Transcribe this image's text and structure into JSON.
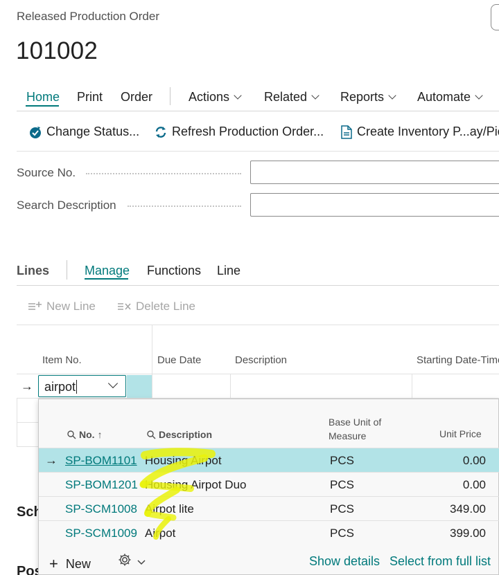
{
  "page": {
    "caption": "Released Production Order",
    "title": "101002"
  },
  "nav": {
    "tabs": [
      {
        "label": "Home"
      },
      {
        "label": "Print"
      },
      {
        "label": "Order"
      },
      {
        "label": "Actions"
      },
      {
        "label": "Related"
      },
      {
        "label": "Reports"
      },
      {
        "label": "Automate"
      }
    ],
    "active": "Home"
  },
  "actions": {
    "change_status": "Change Status...",
    "refresh": "Refresh Production Order...",
    "create_inventory": "Create Inventory P...ay/Pick"
  },
  "fields": {
    "source_no_label": "Source No.",
    "source_no_value": "",
    "search_description_label": "Search Description",
    "search_description_value": ""
  },
  "lines": {
    "title": "Lines",
    "tabs": [
      "Manage",
      "Functions",
      "Line"
    ],
    "active_tab": "Manage",
    "new_line": "New Line",
    "delete_line": "Delete Line",
    "columns": [
      "Item No.",
      "Due Date",
      "Description",
      "Starting Date-Time"
    ],
    "item_input_value": "airpot"
  },
  "sections": {
    "schedule_partial": "Sch",
    "posting_partial": "Posting"
  },
  "lookup": {
    "headers": {
      "no": "No.",
      "sort_indicator": "↑",
      "description": "Description",
      "base_unit_line1": "Base Unit of",
      "base_unit_line2": "Measure",
      "unit_price": "Unit Price"
    },
    "rows": [
      {
        "no": "SP-BOM1101",
        "description": "Housing Airpot",
        "uom": "PCS",
        "unit_price": "0.00",
        "selected": true
      },
      {
        "no": "SP-BOM1201",
        "description": "Housing Airpot Duo",
        "uom": "PCS",
        "unit_price": "0.00",
        "selected": false
      },
      {
        "no": "SP-SCM1008",
        "description": "Airpot lite",
        "uom": "PCS",
        "unit_price": "349.00",
        "selected": false
      },
      {
        "no": "SP-SCM1009",
        "description": "Airpot",
        "uom": "PCS",
        "unit_price": "399.00",
        "selected": false
      }
    ],
    "footer": {
      "new": "New",
      "show_details": "Show details",
      "select_full_list": "Select from full list"
    }
  },
  "colors": {
    "accent": "#00797b",
    "selected_row": "#b2e3e7",
    "highlighter": "#f2f20a"
  },
  "icons": {
    "row_arrow": "→",
    "plus": "+"
  }
}
